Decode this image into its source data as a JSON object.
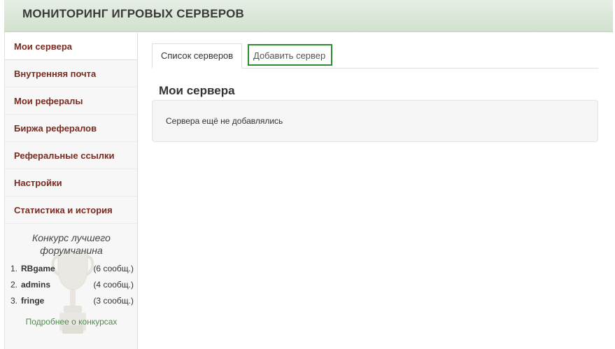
{
  "header": {
    "title": "МОНИТОРИНГ ИГРОВЫХ СЕРВЕРОВ"
  },
  "sidebar": {
    "items": [
      {
        "label": "Мои сервера",
        "active": true
      },
      {
        "label": "Внутренняя почта"
      },
      {
        "label": "Мои рефералы"
      },
      {
        "label": "Биржа рефералов"
      },
      {
        "label": "Реферальные ссылки"
      },
      {
        "label": "Настройки"
      },
      {
        "label": "Статистика и история"
      }
    ],
    "contest": {
      "title_line1": "Конкурс лучшего",
      "title_line2": "форумчанина",
      "leaders": [
        {
          "rank": "1.",
          "name": "RBgame",
          "count": "(6 сообщ.)"
        },
        {
          "rank": "2.",
          "name": "admins",
          "count": "(4 сообщ.)"
        },
        {
          "rank": "3.",
          "name": "fringe",
          "count": "(3 сообщ.)"
        }
      ],
      "more_link": "Подробнее о конкурсах"
    }
  },
  "main": {
    "tabs": [
      {
        "label": "Список серверов"
      },
      {
        "label": "Добавить сервер"
      }
    ],
    "section_title": "Мои сервера",
    "empty_message": "Сервера ещё не добавлялись"
  },
  "colors": {
    "menu_link": "#7a2a1e",
    "accent_green": "#2e8b2e",
    "link_green": "#4f8a4f"
  },
  "icons": {
    "contest": "trophy-icon"
  }
}
